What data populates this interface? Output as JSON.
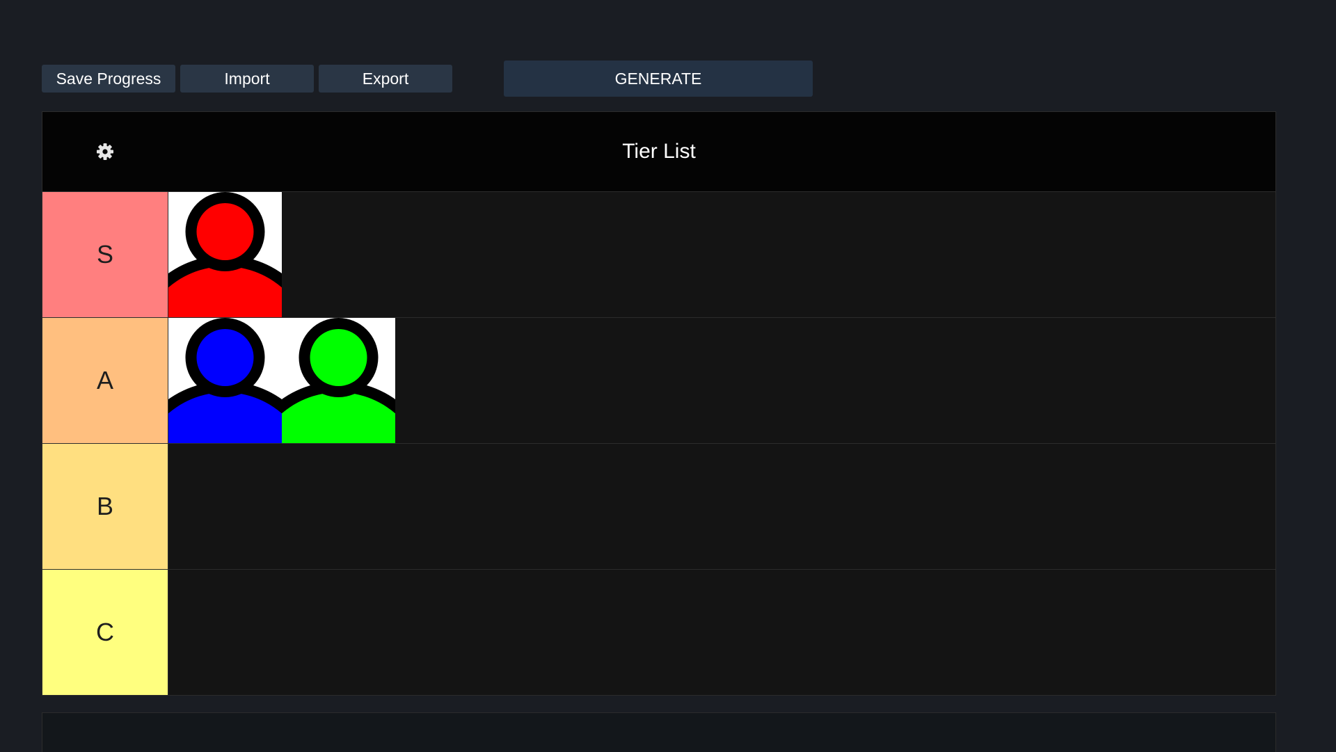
{
  "toolbar": {
    "save_label": "Save Progress",
    "import_label": "Import",
    "export_label": "Export",
    "generate_label": "GENERATE"
  },
  "header": {
    "title": "Tier List",
    "settings_icon": "gear-icon"
  },
  "tiers": [
    {
      "label": "S",
      "color": "#ff7f7f",
      "items": [
        {
          "icon": "person-icon",
          "color": "#ff0000"
        }
      ]
    },
    {
      "label": "A",
      "color": "#ffbf7f",
      "items": [
        {
          "icon": "person-icon",
          "color": "#0000ff"
        },
        {
          "icon": "person-icon",
          "color": "#00ff00"
        }
      ]
    },
    {
      "label": "B",
      "color": "#ffdf80",
      "items": []
    },
    {
      "label": "C",
      "color": "#ffff7f",
      "items": []
    }
  ]
}
